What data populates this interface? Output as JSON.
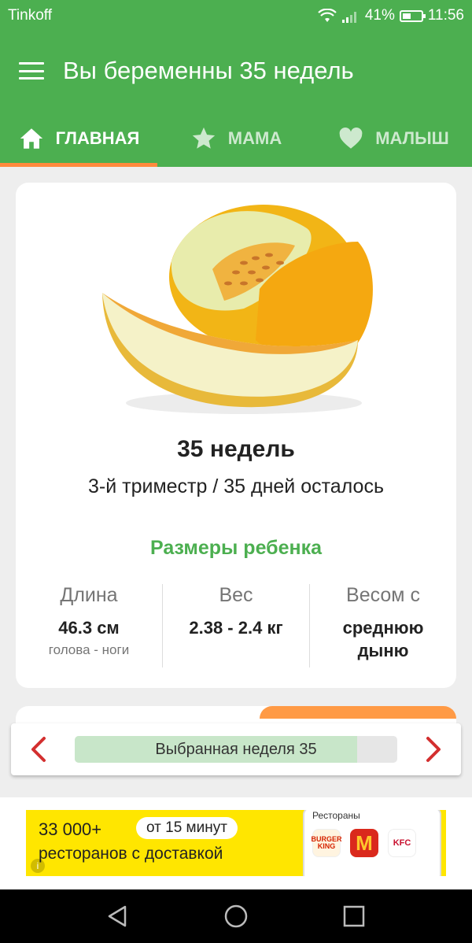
{
  "status_bar": {
    "carrier": "Tinkoff",
    "battery": "41%",
    "time": "11:56"
  },
  "app_bar": {
    "title": "Вы беременны 35 недель"
  },
  "tabs": [
    {
      "label": "ГЛАВНАЯ",
      "icon": "home-icon",
      "active": true
    },
    {
      "label": "МАМА",
      "icon": "star-icon",
      "active": false
    },
    {
      "label": "МАЛЫШ",
      "icon": "heart-icon",
      "active": false
    }
  ],
  "main_card": {
    "image": "melon-image",
    "weeks": "35 недель",
    "trimester": "3-й триместр / 35 дней осталось",
    "sizes_title": "Размеры ребенка",
    "stats": [
      {
        "label": "Длина",
        "value": "46.3 см",
        "sub": "голова - ноги"
      },
      {
        "label": "Вес",
        "value": "2.38 - 2.4 кг",
        "sub": ""
      },
      {
        "label": "Весом с",
        "value": "среднюю дыню",
        "sub": ""
      }
    ]
  },
  "week_nav": {
    "label": "Выбранная неделя 35",
    "progress_fraction": 0.875
  },
  "ad": {
    "line1": "33 000+",
    "pill": "от 15 минут",
    "line2": "ресторанов  с доставкой",
    "phone_title": "Рестораны",
    "info_icon": "info-icon",
    "logos": [
      "BURGER KING",
      "M",
      "KFC"
    ]
  },
  "colors": {
    "primary": "#4caf50",
    "accent": "#ff8a3d",
    "nav_arrow": "#d32f2f",
    "ad_bg": "#ffe600"
  }
}
